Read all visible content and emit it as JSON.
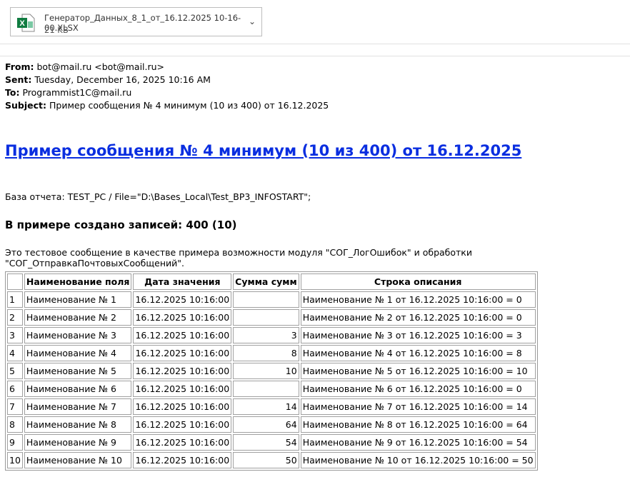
{
  "attachment": {
    "name": "Генератор_Данных_8_1_от_16.12.2025 10-16-00.XLSX",
    "size": "21 KB",
    "icon": "excel-icon"
  },
  "header": {
    "from_label": "From:",
    "from": "bot@mail.ru <bot@mail.ru>",
    "sent_label": "Sent:",
    "sent": "Tuesday, December 16, 2025 10:16 AM",
    "to_label": "To:",
    "to": "Programmist1C@mail.ru",
    "subject_label": "Subject:",
    "subject": "Пример сообщения № 4 минимум (10 из 400) от 16.12.2025"
  },
  "body": {
    "title": "Пример сообщения № 4 минимум (10 из 400) от 16.12.2025",
    "base": "База отчета: TEST_PC / File=\"D:\\Bases_Local\\Test_BP3_INFOSTART\";",
    "count": "В примере создано записей: 400 (10)",
    "description": "Это тестовое сообщение в качестве примера возможности модуля \"СОГ_ЛогОшибок\" и обработки \"СОГ_ОтправкаПочтовыхСообщений\"."
  },
  "table": {
    "headers": [
      "",
      "Наименование поля",
      "Дата значения",
      "Сумма сумм",
      "Строка описания"
    ],
    "rows": [
      [
        "1",
        "Наименование № 1",
        "16.12.2025 10:16:00",
        "",
        "Наименование № 1 от 16.12.2025 10:16:00 = 0"
      ],
      [
        "2",
        "Наименование № 2",
        "16.12.2025 10:16:00",
        "",
        "Наименование № 2 от 16.12.2025 10:16:00 = 0"
      ],
      [
        "3",
        "Наименование № 3",
        "16.12.2025 10:16:00",
        "3",
        "Наименование № 3 от 16.12.2025 10:16:00 = 3"
      ],
      [
        "4",
        "Наименование № 4",
        "16.12.2025 10:16:00",
        "8",
        "Наименование № 4 от 16.12.2025 10:16:00 = 8"
      ],
      [
        "5",
        "Наименование № 5",
        "16.12.2025 10:16:00",
        "10",
        "Наименование № 5 от 16.12.2025 10:16:00 = 10"
      ],
      [
        "6",
        "Наименование № 6",
        "16.12.2025 10:16:00",
        "",
        "Наименование № 6 от 16.12.2025 10:16:00 = 0"
      ],
      [
        "7",
        "Наименование № 7",
        "16.12.2025 10:16:00",
        "14",
        "Наименование № 7 от 16.12.2025 10:16:00 = 14"
      ],
      [
        "8",
        "Наименование № 8",
        "16.12.2025 10:16:00",
        "64",
        "Наименование № 8 от 16.12.2025 10:16:00 = 64"
      ],
      [
        "9",
        "Наименование № 9",
        "16.12.2025 10:16:00",
        "54",
        "Наименование № 9 от 16.12.2025 10:16:00 = 54"
      ],
      [
        "10",
        "Наименование № 10",
        "16.12.2025 10:16:00",
        "50",
        "Наименование № 10 от 16.12.2025 10:16:00 = 50"
      ]
    ]
  }
}
